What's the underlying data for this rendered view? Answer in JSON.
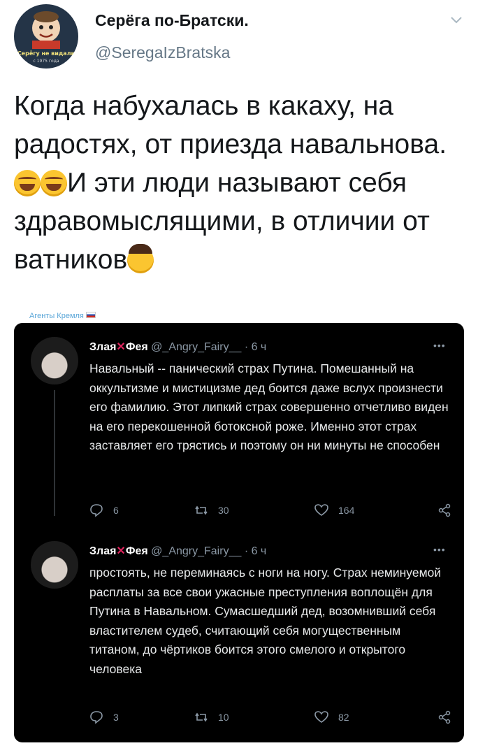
{
  "author": {
    "name": "Серёга по-Братски.",
    "handle": "@SeregaIzBratska",
    "avatar_caption": "Серёгу не видали",
    "avatar_subcaption": "с 1975 года"
  },
  "tweet": {
    "text_part1": "Когда набухалась в какаху, на радостях, от приезда навальнова. ",
    "text_part2": "И эти люди называют себя здравомыслящими, в отличии от ватников",
    "emojis": [
      "rolling-on-floor-laughing",
      "rolling-on-floor-laughing",
      "face-palm"
    ]
  },
  "watermark": "Агенты Кремля",
  "replies": [
    {
      "name": "Злая",
      "name_suffix": "Фея",
      "handle": "@_Angry_Fairy__",
      "time": "· 6 ч",
      "text": "Навальный -- панический страх Путина. Помешанный на оккультизме и мистицизме дед боится даже вслух произнести его фамилию. Этот липкий страх совершенно отчетливо виден на его перекошенной ботоксной роже. Именно этот страх заставляет его трястись и поэтому он ни минуты не способен",
      "replies": "6",
      "retweets": "30",
      "likes": "164"
    },
    {
      "name": "Злая",
      "name_suffix": "Фея",
      "handle": "@_Angry_Fairy__",
      "time": "· 6 ч",
      "text": "простоять, не переминаясь с ноги на ногу. Страх неминуемой расплаты за все свои ужасные преступления воплощён для Путина в Навальном. Сумасшедший дед, возомнивший себя властителем судеб, считающий себя могущественным титаном, до чёртиков боится этого смелого и открытого человека",
      "replies": "3",
      "retweets": "10",
      "likes": "82"
    }
  ],
  "colors": {
    "accent": "#1da1f2",
    "card_bg": "#000000",
    "muted": "#8b98a5",
    "handle_gray": "#657786"
  }
}
